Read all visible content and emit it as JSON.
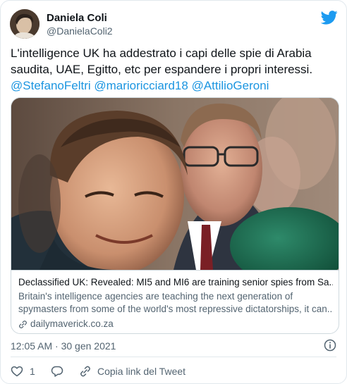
{
  "author": {
    "name": "Daniela Coli",
    "handle": "@DanielaColi2"
  },
  "tweet": {
    "text_line1": "L'intelligence UK ha addestrato i capi delle spie di Arabia",
    "text_line2": "saudita, UAE, Egitto, etc per espandere i propri interessi.",
    "mentions": [
      "@StefanoFeltri",
      "@marioricciard18",
      "@AttilioGeroni"
    ]
  },
  "card": {
    "title": "Declassified UK: Revealed: MI5 and MI6 are training senior spies from Sa...",
    "description_line1": "Britain's intelligence agencies are teaching the next generation of",
    "description_line2": "spymasters from some of the world's most repressive dictatorships, it can...",
    "domain": "dailymaverick.co.za"
  },
  "meta": {
    "timestamp": "12:05 AM · 30 gen 2021"
  },
  "actions": {
    "like_count": "1",
    "copy_link_label": "Copia link del Tweet"
  },
  "colors": {
    "accent": "#1b95e0",
    "like": "#536471",
    "text": "#0f1419",
    "secondary": "#536471"
  },
  "icons": [
    "twitter-bird-icon",
    "link-icon",
    "info-icon",
    "heart-icon",
    "reply-icon",
    "copy-link-icon"
  ]
}
